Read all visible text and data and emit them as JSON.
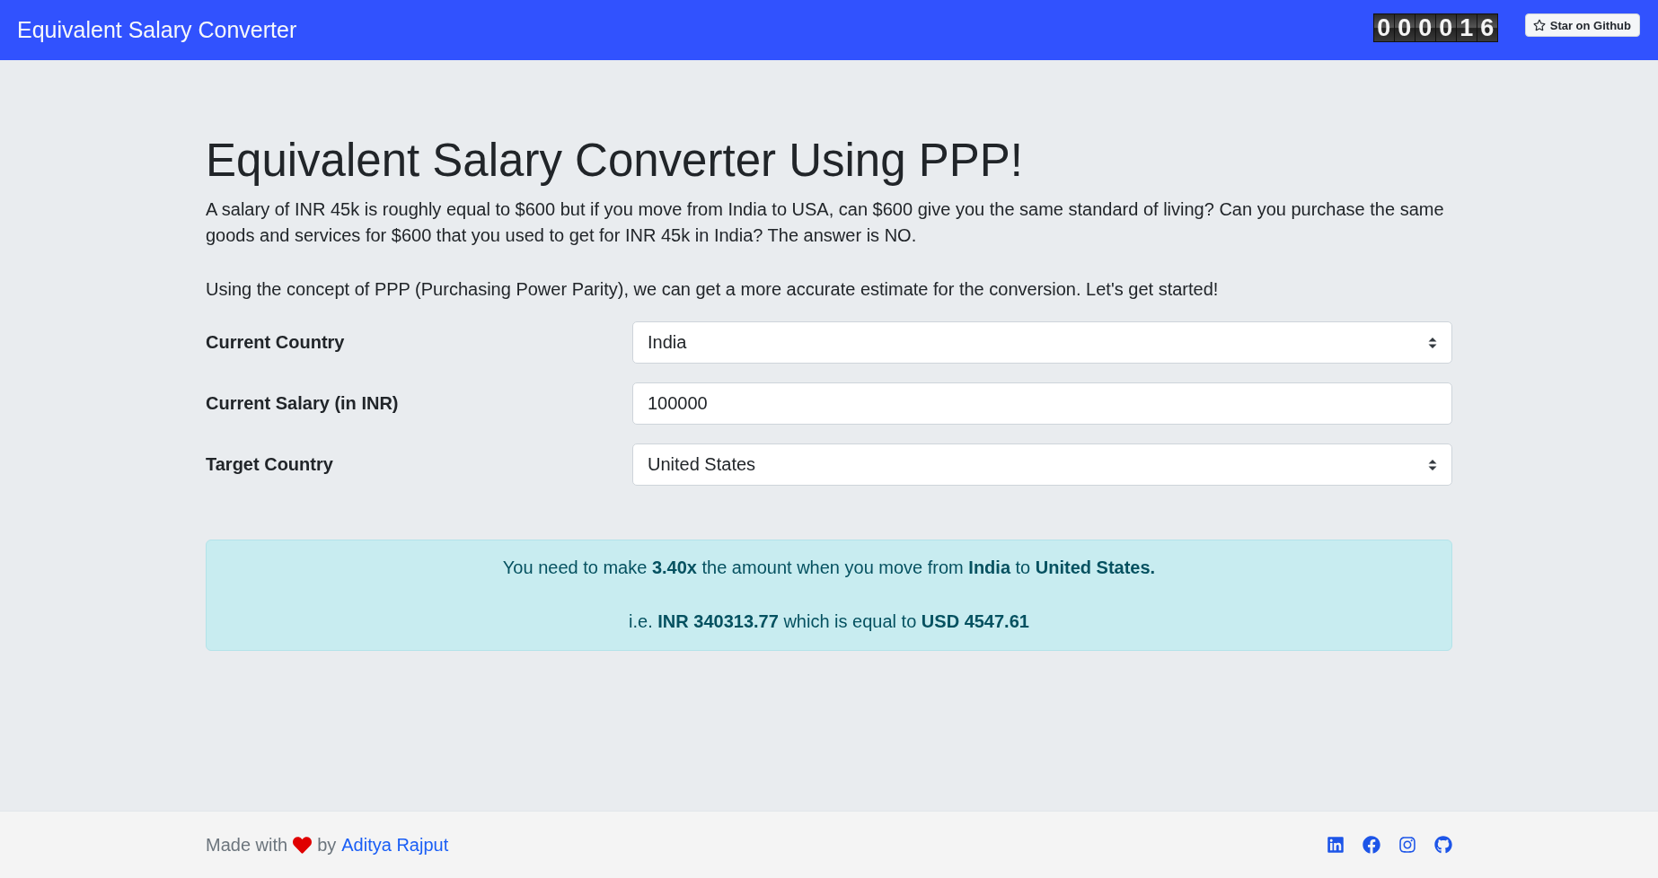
{
  "navbar": {
    "title": "Equivalent Salary Converter",
    "hit_counter": "000016",
    "star_button": "Star on Github"
  },
  "intro": {
    "heading": "Equivalent Salary Converter Using PPP!",
    "paragraphs": [
      "A salary of INR 45k is roughly equal to $600 but if you move from India to USA, can $600 give you the same standard of living? Can you purchase the same goods and services for $600 that you used to get for INR 45k in India? The answer is NO.",
      "Using the concept of PPP (Purchasing Power Parity), we can get a more accurate estimate for the conversion. Let's get started!"
    ]
  },
  "form": {
    "fields": [
      {
        "kind": "select",
        "label": "Current Country",
        "value": "India"
      },
      {
        "kind": "text",
        "label": "Current Salary (in INR)",
        "value": "100000"
      },
      {
        "kind": "select",
        "label": "Target Country",
        "value": "United States"
      }
    ]
  },
  "result": {
    "lines": [
      "You need to make **3.40x** the amount when you move from **India** to **United States.**",
      "i.e. **INR 340313.77** which is equal to **USD 4547.61**"
    ]
  },
  "footer": {
    "made_with": "Made with",
    "by": "by",
    "author_link": "Aditya Rajput"
  }
}
